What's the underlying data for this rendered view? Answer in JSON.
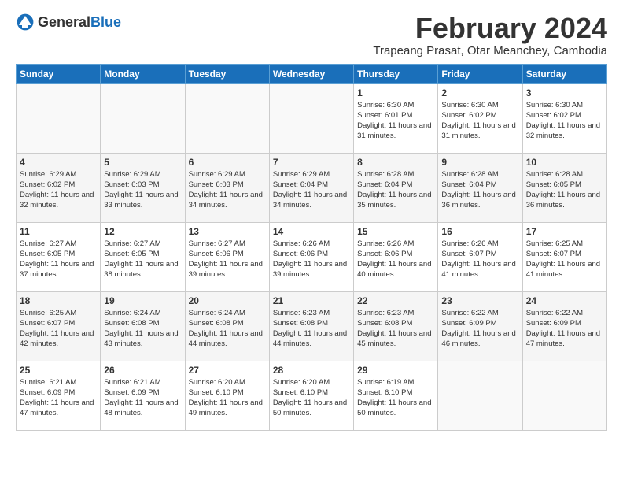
{
  "logo": {
    "general": "General",
    "blue": "Blue"
  },
  "title": "February 2024",
  "subtitle": "Trapeang Prasat, Otar Meanchey, Cambodia",
  "days_of_week": [
    "Sunday",
    "Monday",
    "Tuesday",
    "Wednesday",
    "Thursday",
    "Friday",
    "Saturday"
  ],
  "weeks": [
    [
      {
        "day": "",
        "sunrise": "",
        "sunset": "",
        "daylight": ""
      },
      {
        "day": "",
        "sunrise": "",
        "sunset": "",
        "daylight": ""
      },
      {
        "day": "",
        "sunrise": "",
        "sunset": "",
        "daylight": ""
      },
      {
        "day": "",
        "sunrise": "",
        "sunset": "",
        "daylight": ""
      },
      {
        "day": "1",
        "sunrise": "Sunrise: 6:30 AM",
        "sunset": "Sunset: 6:01 PM",
        "daylight": "Daylight: 11 hours and 31 minutes."
      },
      {
        "day": "2",
        "sunrise": "Sunrise: 6:30 AM",
        "sunset": "Sunset: 6:02 PM",
        "daylight": "Daylight: 11 hours and 31 minutes."
      },
      {
        "day": "3",
        "sunrise": "Sunrise: 6:30 AM",
        "sunset": "Sunset: 6:02 PM",
        "daylight": "Daylight: 11 hours and 32 minutes."
      }
    ],
    [
      {
        "day": "4",
        "sunrise": "Sunrise: 6:29 AM",
        "sunset": "Sunset: 6:02 PM",
        "daylight": "Daylight: 11 hours and 32 minutes."
      },
      {
        "day": "5",
        "sunrise": "Sunrise: 6:29 AM",
        "sunset": "Sunset: 6:03 PM",
        "daylight": "Daylight: 11 hours and 33 minutes."
      },
      {
        "day": "6",
        "sunrise": "Sunrise: 6:29 AM",
        "sunset": "Sunset: 6:03 PM",
        "daylight": "Daylight: 11 hours and 34 minutes."
      },
      {
        "day": "7",
        "sunrise": "Sunrise: 6:29 AM",
        "sunset": "Sunset: 6:04 PM",
        "daylight": "Daylight: 11 hours and 34 minutes."
      },
      {
        "day": "8",
        "sunrise": "Sunrise: 6:28 AM",
        "sunset": "Sunset: 6:04 PM",
        "daylight": "Daylight: 11 hours and 35 minutes."
      },
      {
        "day": "9",
        "sunrise": "Sunrise: 6:28 AM",
        "sunset": "Sunset: 6:04 PM",
        "daylight": "Daylight: 11 hours and 36 minutes."
      },
      {
        "day": "10",
        "sunrise": "Sunrise: 6:28 AM",
        "sunset": "Sunset: 6:05 PM",
        "daylight": "Daylight: 11 hours and 36 minutes."
      }
    ],
    [
      {
        "day": "11",
        "sunrise": "Sunrise: 6:27 AM",
        "sunset": "Sunset: 6:05 PM",
        "daylight": "Daylight: 11 hours and 37 minutes."
      },
      {
        "day": "12",
        "sunrise": "Sunrise: 6:27 AM",
        "sunset": "Sunset: 6:05 PM",
        "daylight": "Daylight: 11 hours and 38 minutes."
      },
      {
        "day": "13",
        "sunrise": "Sunrise: 6:27 AM",
        "sunset": "Sunset: 6:06 PM",
        "daylight": "Daylight: 11 hours and 39 minutes."
      },
      {
        "day": "14",
        "sunrise": "Sunrise: 6:26 AM",
        "sunset": "Sunset: 6:06 PM",
        "daylight": "Daylight: 11 hours and 39 minutes."
      },
      {
        "day": "15",
        "sunrise": "Sunrise: 6:26 AM",
        "sunset": "Sunset: 6:06 PM",
        "daylight": "Daylight: 11 hours and 40 minutes."
      },
      {
        "day": "16",
        "sunrise": "Sunrise: 6:26 AM",
        "sunset": "Sunset: 6:07 PM",
        "daylight": "Daylight: 11 hours and 41 minutes."
      },
      {
        "day": "17",
        "sunrise": "Sunrise: 6:25 AM",
        "sunset": "Sunset: 6:07 PM",
        "daylight": "Daylight: 11 hours and 41 minutes."
      }
    ],
    [
      {
        "day": "18",
        "sunrise": "Sunrise: 6:25 AM",
        "sunset": "Sunset: 6:07 PM",
        "daylight": "Daylight: 11 hours and 42 minutes."
      },
      {
        "day": "19",
        "sunrise": "Sunrise: 6:24 AM",
        "sunset": "Sunset: 6:08 PM",
        "daylight": "Daylight: 11 hours and 43 minutes."
      },
      {
        "day": "20",
        "sunrise": "Sunrise: 6:24 AM",
        "sunset": "Sunset: 6:08 PM",
        "daylight": "Daylight: 11 hours and 44 minutes."
      },
      {
        "day": "21",
        "sunrise": "Sunrise: 6:23 AM",
        "sunset": "Sunset: 6:08 PM",
        "daylight": "Daylight: 11 hours and 44 minutes."
      },
      {
        "day": "22",
        "sunrise": "Sunrise: 6:23 AM",
        "sunset": "Sunset: 6:08 PM",
        "daylight": "Daylight: 11 hours and 45 minutes."
      },
      {
        "day": "23",
        "sunrise": "Sunrise: 6:22 AM",
        "sunset": "Sunset: 6:09 PM",
        "daylight": "Daylight: 11 hours and 46 minutes."
      },
      {
        "day": "24",
        "sunrise": "Sunrise: 6:22 AM",
        "sunset": "Sunset: 6:09 PM",
        "daylight": "Daylight: 11 hours and 47 minutes."
      }
    ],
    [
      {
        "day": "25",
        "sunrise": "Sunrise: 6:21 AM",
        "sunset": "Sunset: 6:09 PM",
        "daylight": "Daylight: 11 hours and 47 minutes."
      },
      {
        "day": "26",
        "sunrise": "Sunrise: 6:21 AM",
        "sunset": "Sunset: 6:09 PM",
        "daylight": "Daylight: 11 hours and 48 minutes."
      },
      {
        "day": "27",
        "sunrise": "Sunrise: 6:20 AM",
        "sunset": "Sunset: 6:10 PM",
        "daylight": "Daylight: 11 hours and 49 minutes."
      },
      {
        "day": "28",
        "sunrise": "Sunrise: 6:20 AM",
        "sunset": "Sunset: 6:10 PM",
        "daylight": "Daylight: 11 hours and 50 minutes."
      },
      {
        "day": "29",
        "sunrise": "Sunrise: 6:19 AM",
        "sunset": "Sunset: 6:10 PM",
        "daylight": "Daylight: 11 hours and 50 minutes."
      },
      {
        "day": "",
        "sunrise": "",
        "sunset": "",
        "daylight": ""
      },
      {
        "day": "",
        "sunrise": "",
        "sunset": "",
        "daylight": ""
      }
    ]
  ]
}
